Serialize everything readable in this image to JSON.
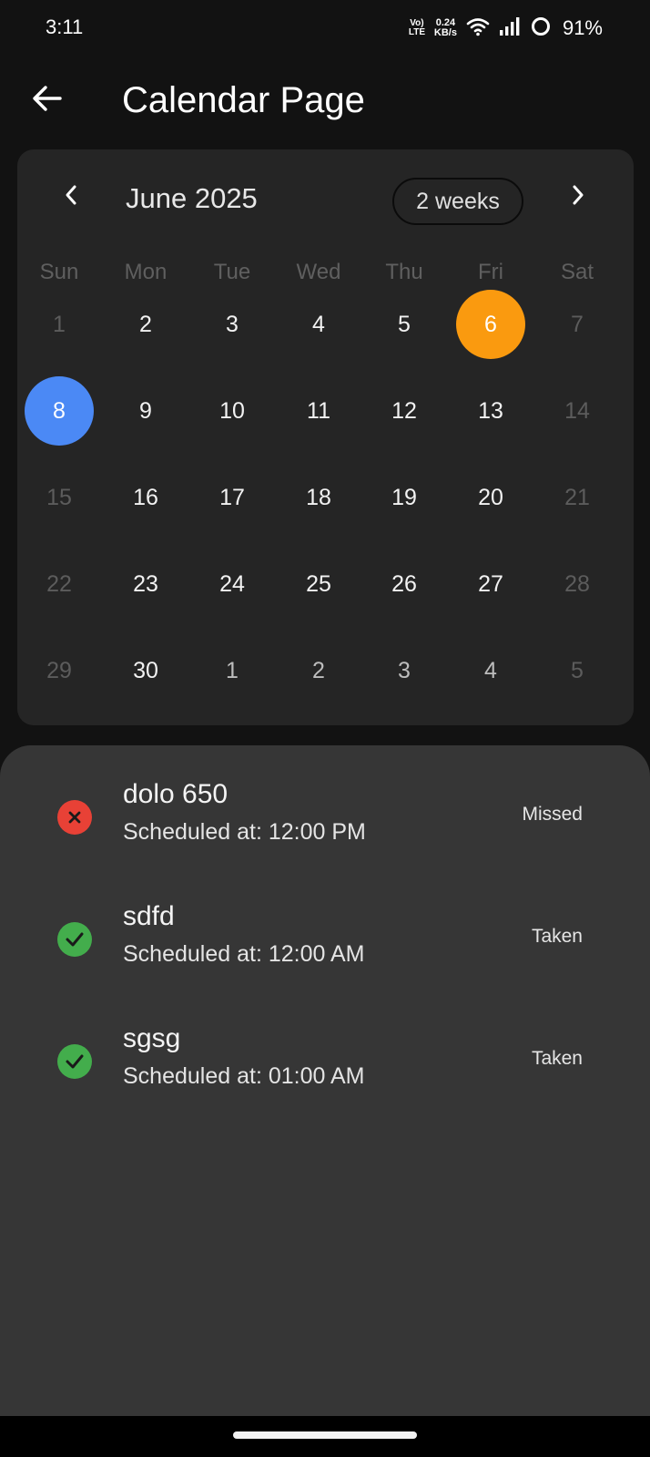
{
  "status_bar": {
    "time": "3:11",
    "volte_line1": "Vo)",
    "volte_line2": "LTE",
    "net_speed_value": "0.24",
    "net_speed_unit": "KB/s",
    "battery": "91%",
    "icons": [
      "wifi-icon",
      "signal-icon",
      "battery-ring-icon"
    ]
  },
  "app_bar": {
    "title": "Calendar Page",
    "back_icon": "arrow-left-icon"
  },
  "calendar": {
    "month_label": "June 2025",
    "format_button": "2 weeks",
    "prev_icon": "chevron-left-icon",
    "next_icon": "chevron-right-icon",
    "weekdays": [
      "Sun",
      "Mon",
      "Tue",
      "Wed",
      "Thu",
      "Fri",
      "Sat"
    ],
    "weeks": [
      [
        "1",
        "2",
        "3",
        "4",
        "5",
        "6",
        "7"
      ],
      [
        "8",
        "9",
        "10",
        "11",
        "12",
        "13",
        "14"
      ],
      [
        "15",
        "16",
        "17",
        "18",
        "19",
        "20",
        "21"
      ],
      [
        "22",
        "23",
        "24",
        "25",
        "26",
        "27",
        "28"
      ],
      [
        "29",
        "30",
        "1",
        "2",
        "3",
        "4",
        "5"
      ]
    ],
    "today": "6",
    "selected": "8",
    "colors": {
      "today": "#fa9a0f",
      "selected": "#4b89f5",
      "card_bg": "#252525"
    }
  },
  "events": [
    {
      "name": "dolo 650",
      "time": "Scheduled at: 12:00 PM",
      "status": "Missed",
      "icon": "cancel-icon",
      "color": "#e84136"
    },
    {
      "name": "sdfd",
      "time": "Scheduled at: 12:00 AM",
      "status": "Taken",
      "icon": "check-circle-icon",
      "color": "#43ad4c"
    },
    {
      "name": "sgsg",
      "time": "Scheduled at: 01:00 AM",
      "status": "Taken",
      "icon": "check-circle-icon",
      "color": "#43ad4c"
    }
  ]
}
